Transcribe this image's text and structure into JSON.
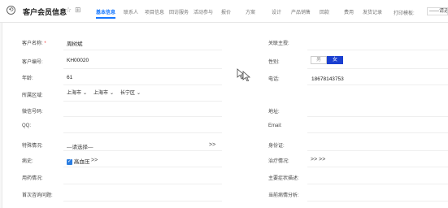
{
  "header": {
    "title": "客户会员信息",
    "tabs": [
      "基本信息",
      "联系人",
      "项目信息",
      "回访服务",
      "活动参与",
      "报价",
      "方案",
      "设计",
      "产品销售",
      "回款",
      "费用",
      "发货记录"
    ],
    "active_tab": 0,
    "print_label": "打印模板:",
    "print_value": "——请选择"
  },
  "form": {
    "customer_name_label": "客户名称:",
    "required_mark": "*",
    "customer_name": "周树斌",
    "customer_id_label": "客户编号:",
    "customer_id": "KH00020",
    "age_label": "年龄:",
    "age": "61",
    "region_label": "所属区域:",
    "province": "上海市",
    "city": "上海市",
    "district": "长宁区",
    "wechat_label": "微信号码:",
    "qq_label": "QQ:",
    "special_label": "特殊情况:",
    "special_placeholder": "—请选择—",
    "special_arrow": ">>",
    "disease_label": "病史:",
    "disease_value": "高血压",
    "disease_arrow": ">>",
    "medication_label": "用药情况:",
    "first_consult_label": "首次咨询问题:",
    "related_label": "关联主授:",
    "gender_label": "性别:",
    "gender_options": [
      "男",
      "女"
    ],
    "gender_selected": 1,
    "phone_label": "电话:",
    "phone": "18678143753",
    "address_label": "地址:",
    "email_label": "Email:",
    "id_label": "身份证:",
    "treatment_label": "治疗情况:",
    "treatment_arrow": ">> >>",
    "symptom_label": "主要症状描述:",
    "condition_label": "当前病情分析:"
  },
  "colors": {
    "accent": "#1677ff",
    "gender_active": "#1a3fd0",
    "checkbox": "#2a7de1"
  },
  "icons": [
    "back-icon",
    "star-icon",
    "grid-icon",
    "chevron-down-icon",
    "checkbox-checked-icon",
    "cursor-icon"
  ]
}
